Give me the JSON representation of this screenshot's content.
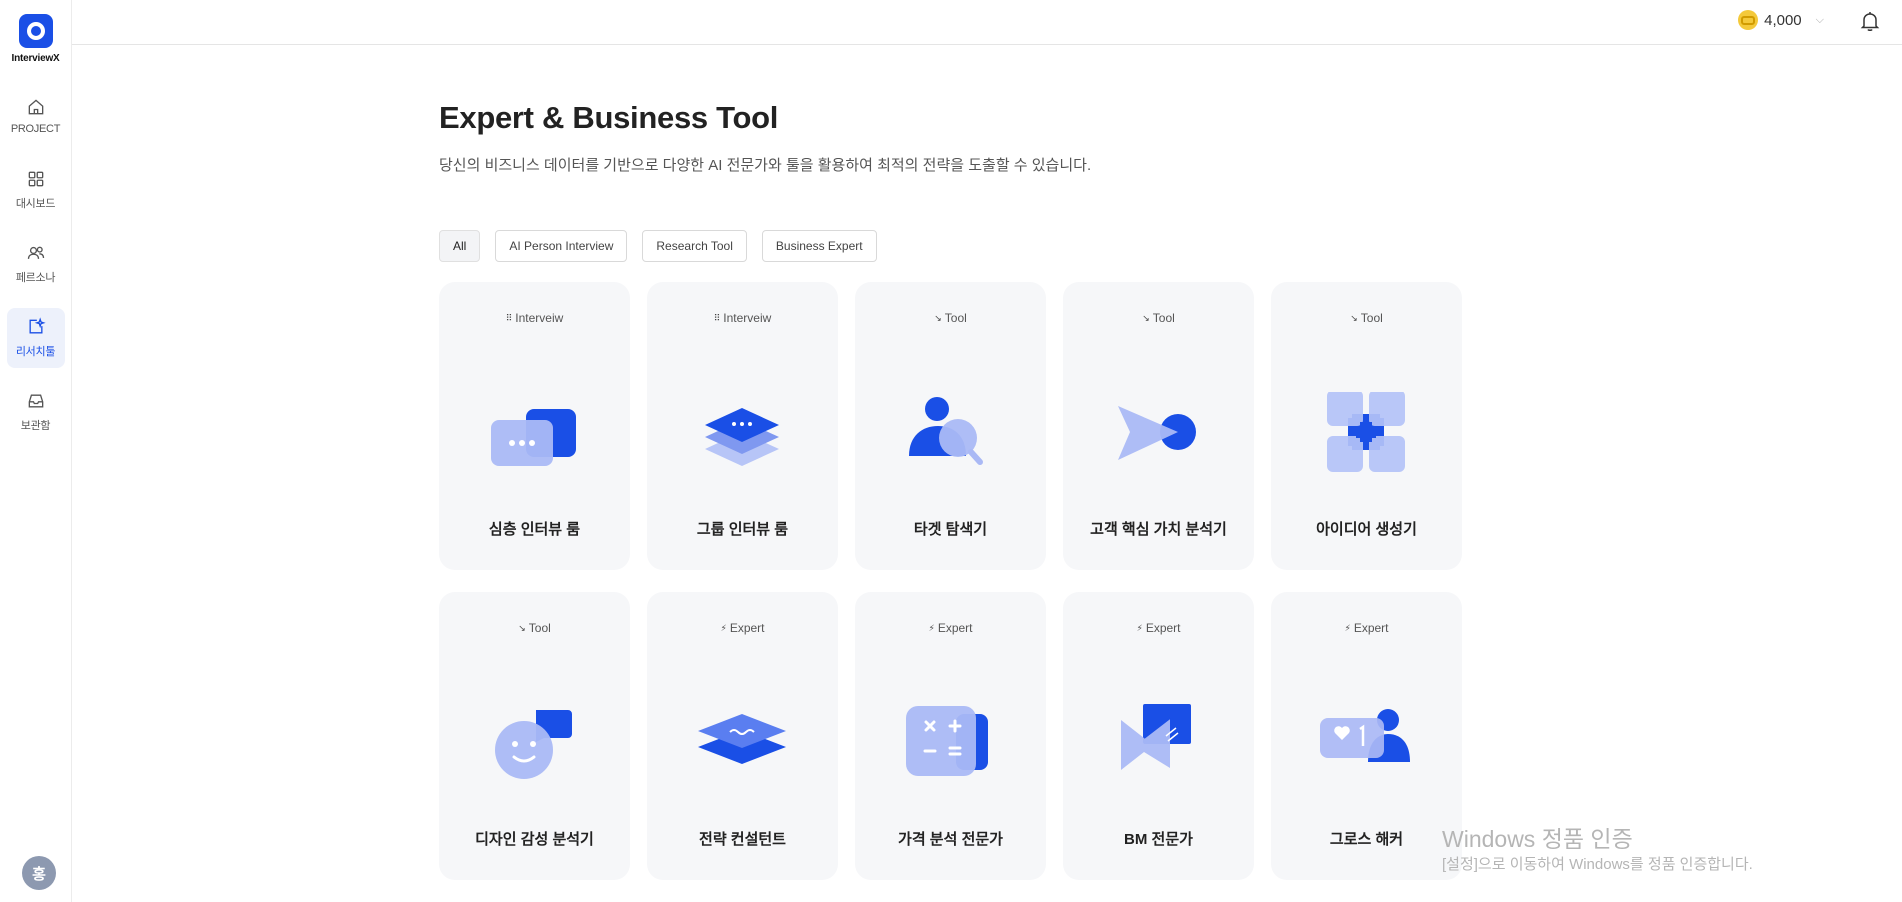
{
  "app": {
    "logo_text": "InterviewX"
  },
  "sidebar": {
    "items": [
      {
        "label": "PROJECT",
        "icon": "home-icon"
      },
      {
        "label": "대시보드",
        "icon": "grid-icon"
      },
      {
        "label": "페르소나",
        "icon": "users-icon"
      },
      {
        "label": "리서치툴",
        "icon": "edit-sparkle-icon",
        "active": true
      },
      {
        "label": "보관함",
        "icon": "inbox-icon"
      }
    ],
    "avatar": "홍"
  },
  "topbar": {
    "credits": "4,000"
  },
  "page": {
    "title": "Expert & Business Tool",
    "subtitle": "당신의 비즈니스 데이터를 기반으로 다양한 AI 전문가와 툴을 활용하여 최적의 전략을 도출할 수 있습니다."
  },
  "filters": [
    "All",
    "AI Person Interview",
    "Research Tool",
    "Business Expert"
  ],
  "cards": [
    {
      "tag": "Interveiw",
      "tag_glyph": "⠿",
      "name": "심층 인터뷰 룸",
      "icon": "chat-bubbles-icon"
    },
    {
      "tag": "Interveiw",
      "tag_glyph": "⠿",
      "name": "그룹 인터뷰 룸",
      "icon": "stacked-layers-icon"
    },
    {
      "tag": "Tool",
      "tag_glyph": "↘",
      "name": "타겟 탐색기",
      "icon": "person-search-icon"
    },
    {
      "tag": "Tool",
      "tag_glyph": "↘",
      "name": "고객 핵심 가치 분석기",
      "icon": "arrow-target-icon"
    },
    {
      "tag": "Tool",
      "tag_glyph": "↘",
      "name": "아이디어 생성기",
      "icon": "four-squares-icon"
    },
    {
      "tag": "Tool",
      "tag_glyph": "↘",
      "name": "디자인 감성 분석기",
      "icon": "smile-face-icon"
    },
    {
      "tag": "Expert",
      "tag_glyph": "⚡",
      "name": "전략 컨설턴트",
      "icon": "layered-diamond-icon"
    },
    {
      "tag": "Expert",
      "tag_glyph": "⚡",
      "name": "가격 분석 전문가",
      "icon": "calculator-icon"
    },
    {
      "tag": "Expert",
      "tag_glyph": "⚡",
      "name": "BM 전문가",
      "icon": "folded-card-icon"
    },
    {
      "tag": "Expert",
      "tag_glyph": "⚡",
      "name": "그로스 해커",
      "icon": "like-notification-icon"
    }
  ],
  "watermark": {
    "line1": "Windows 정품 인증",
    "line2": "[설정]으로 이동하여 Windows를 정품 인증합니다."
  }
}
